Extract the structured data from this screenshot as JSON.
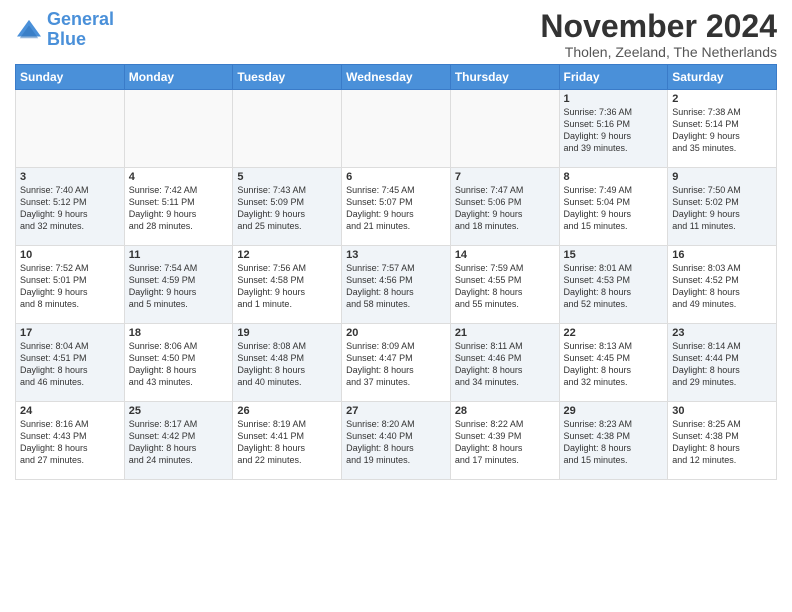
{
  "header": {
    "logo_line1": "General",
    "logo_line2": "Blue",
    "month_title": "November 2024",
    "subtitle": "Tholen, Zeeland, The Netherlands"
  },
  "days_of_week": [
    "Sunday",
    "Monday",
    "Tuesday",
    "Wednesday",
    "Thursday",
    "Friday",
    "Saturday"
  ],
  "weeks": [
    [
      {
        "day": "",
        "info": "",
        "empty": true
      },
      {
        "day": "",
        "info": "",
        "empty": true
      },
      {
        "day": "",
        "info": "",
        "empty": true
      },
      {
        "day": "",
        "info": "",
        "empty": true
      },
      {
        "day": "",
        "info": "",
        "empty": true
      },
      {
        "day": "1",
        "info": "Sunrise: 7:36 AM\nSunset: 5:16 PM\nDaylight: 9 hours\nand 39 minutes.",
        "shaded": true
      },
      {
        "day": "2",
        "info": "Sunrise: 7:38 AM\nSunset: 5:14 PM\nDaylight: 9 hours\nand 35 minutes.",
        "shaded": false
      }
    ],
    [
      {
        "day": "3",
        "info": "Sunrise: 7:40 AM\nSunset: 5:12 PM\nDaylight: 9 hours\nand 32 minutes.",
        "shaded": true
      },
      {
        "day": "4",
        "info": "Sunrise: 7:42 AM\nSunset: 5:11 PM\nDaylight: 9 hours\nand 28 minutes.",
        "shaded": false
      },
      {
        "day": "5",
        "info": "Sunrise: 7:43 AM\nSunset: 5:09 PM\nDaylight: 9 hours\nand 25 minutes.",
        "shaded": true
      },
      {
        "day": "6",
        "info": "Sunrise: 7:45 AM\nSunset: 5:07 PM\nDaylight: 9 hours\nand 21 minutes.",
        "shaded": false
      },
      {
        "day": "7",
        "info": "Sunrise: 7:47 AM\nSunset: 5:06 PM\nDaylight: 9 hours\nand 18 minutes.",
        "shaded": true
      },
      {
        "day": "8",
        "info": "Sunrise: 7:49 AM\nSunset: 5:04 PM\nDaylight: 9 hours\nand 15 minutes.",
        "shaded": false
      },
      {
        "day": "9",
        "info": "Sunrise: 7:50 AM\nSunset: 5:02 PM\nDaylight: 9 hours\nand 11 minutes.",
        "shaded": true
      }
    ],
    [
      {
        "day": "10",
        "info": "Sunrise: 7:52 AM\nSunset: 5:01 PM\nDaylight: 9 hours\nand 8 minutes.",
        "shaded": false
      },
      {
        "day": "11",
        "info": "Sunrise: 7:54 AM\nSunset: 4:59 PM\nDaylight: 9 hours\nand 5 minutes.",
        "shaded": true
      },
      {
        "day": "12",
        "info": "Sunrise: 7:56 AM\nSunset: 4:58 PM\nDaylight: 9 hours\nand 1 minute.",
        "shaded": false
      },
      {
        "day": "13",
        "info": "Sunrise: 7:57 AM\nSunset: 4:56 PM\nDaylight: 8 hours\nand 58 minutes.",
        "shaded": true
      },
      {
        "day": "14",
        "info": "Sunrise: 7:59 AM\nSunset: 4:55 PM\nDaylight: 8 hours\nand 55 minutes.",
        "shaded": false
      },
      {
        "day": "15",
        "info": "Sunrise: 8:01 AM\nSunset: 4:53 PM\nDaylight: 8 hours\nand 52 minutes.",
        "shaded": true
      },
      {
        "day": "16",
        "info": "Sunrise: 8:03 AM\nSunset: 4:52 PM\nDaylight: 8 hours\nand 49 minutes.",
        "shaded": false
      }
    ],
    [
      {
        "day": "17",
        "info": "Sunrise: 8:04 AM\nSunset: 4:51 PM\nDaylight: 8 hours\nand 46 minutes.",
        "shaded": true
      },
      {
        "day": "18",
        "info": "Sunrise: 8:06 AM\nSunset: 4:50 PM\nDaylight: 8 hours\nand 43 minutes.",
        "shaded": false
      },
      {
        "day": "19",
        "info": "Sunrise: 8:08 AM\nSunset: 4:48 PM\nDaylight: 8 hours\nand 40 minutes.",
        "shaded": true
      },
      {
        "day": "20",
        "info": "Sunrise: 8:09 AM\nSunset: 4:47 PM\nDaylight: 8 hours\nand 37 minutes.",
        "shaded": false
      },
      {
        "day": "21",
        "info": "Sunrise: 8:11 AM\nSunset: 4:46 PM\nDaylight: 8 hours\nand 34 minutes.",
        "shaded": true
      },
      {
        "day": "22",
        "info": "Sunrise: 8:13 AM\nSunset: 4:45 PM\nDaylight: 8 hours\nand 32 minutes.",
        "shaded": false
      },
      {
        "day": "23",
        "info": "Sunrise: 8:14 AM\nSunset: 4:44 PM\nDaylight: 8 hours\nand 29 minutes.",
        "shaded": true
      }
    ],
    [
      {
        "day": "24",
        "info": "Sunrise: 8:16 AM\nSunset: 4:43 PM\nDaylight: 8 hours\nand 27 minutes.",
        "shaded": false
      },
      {
        "day": "25",
        "info": "Sunrise: 8:17 AM\nSunset: 4:42 PM\nDaylight: 8 hours\nand 24 minutes.",
        "shaded": true
      },
      {
        "day": "26",
        "info": "Sunrise: 8:19 AM\nSunset: 4:41 PM\nDaylight: 8 hours\nand 22 minutes.",
        "shaded": false
      },
      {
        "day": "27",
        "info": "Sunrise: 8:20 AM\nSunset: 4:40 PM\nDaylight: 8 hours\nand 19 minutes.",
        "shaded": true
      },
      {
        "day": "28",
        "info": "Sunrise: 8:22 AM\nSunset: 4:39 PM\nDaylight: 8 hours\nand 17 minutes.",
        "shaded": false
      },
      {
        "day": "29",
        "info": "Sunrise: 8:23 AM\nSunset: 4:38 PM\nDaylight: 8 hours\nand 15 minutes.",
        "shaded": true
      },
      {
        "day": "30",
        "info": "Sunrise: 8:25 AM\nSunset: 4:38 PM\nDaylight: 8 hours\nand 12 minutes.",
        "shaded": false
      }
    ]
  ]
}
